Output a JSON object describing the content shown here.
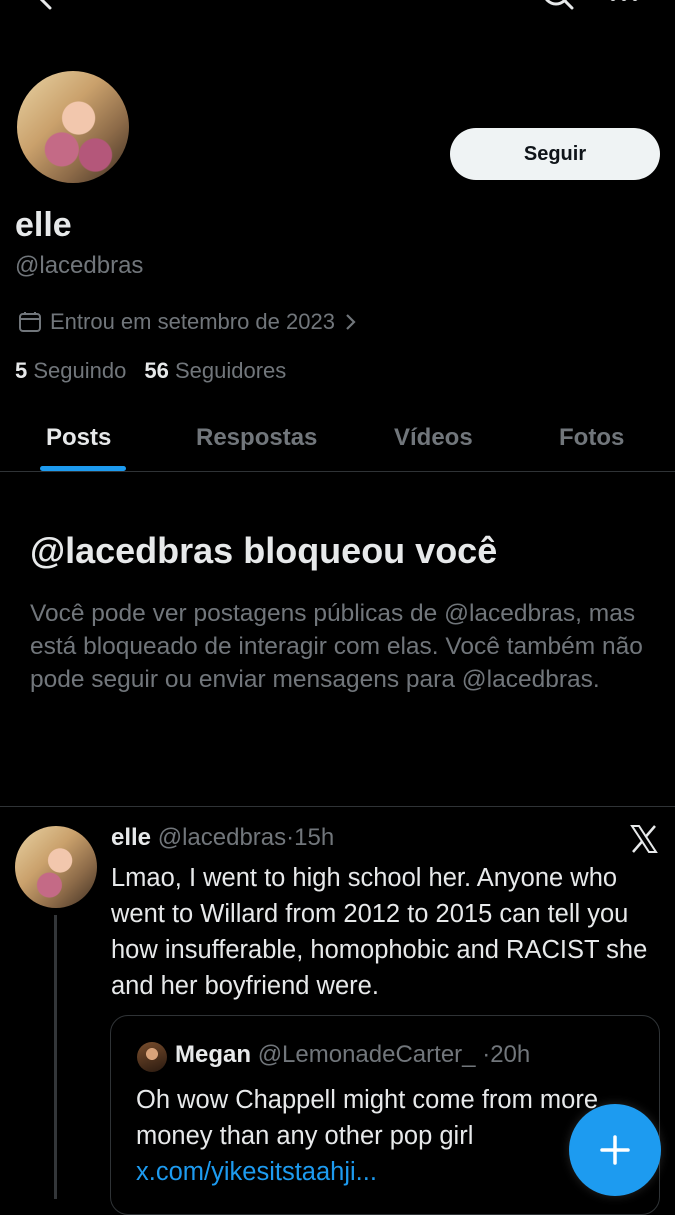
{
  "topbar": {
    "back_icon": "arrow-left-icon",
    "search_icon": "search-icon",
    "more_icon": "more-icon"
  },
  "profile": {
    "name": "elle",
    "handle": "@lacedbras",
    "follow_label": "Seguir",
    "joined": "Entrou em setembro de 2023",
    "following_count": "5",
    "following_label": "Seguindo",
    "followers_count": "56",
    "followers_label": "Seguidores"
  },
  "tabs": [
    {
      "label": "Posts",
      "active": true
    },
    {
      "label": "Respostas",
      "active": false
    },
    {
      "label": "Vídeos",
      "active": false
    },
    {
      "label": "Fotos",
      "active": false
    }
  ],
  "blocked": {
    "title": "@lacedbras bloqueou você",
    "text": "Você pode ver postagens públicas de @lacedbras, mas está bloqueado de interagir com elas. Você também não pode seguir ou enviar mensagens para @lacedbras."
  },
  "tweet": {
    "name": "elle",
    "handle": "@lacedbras",
    "sep": "·",
    "time": "15h",
    "text": "Lmao, I went to high school her. Anyone who went to Willard from 2012 to 2015 can tell you how insufferable, homophobic and RACIST she and her boyfriend were.",
    "quote": {
      "name": "Megan",
      "handle": "@LemonadeCarter_",
      "sep": "·",
      "time": "20h",
      "text": "Oh wow Chappell might come from more money than any other pop girl",
      "link": "x.com/yikesitstaahji..."
    }
  },
  "colors": {
    "accent": "#1d9bf0",
    "muted": "#71767b",
    "text": "#e7e9ea",
    "background": "#000000"
  }
}
